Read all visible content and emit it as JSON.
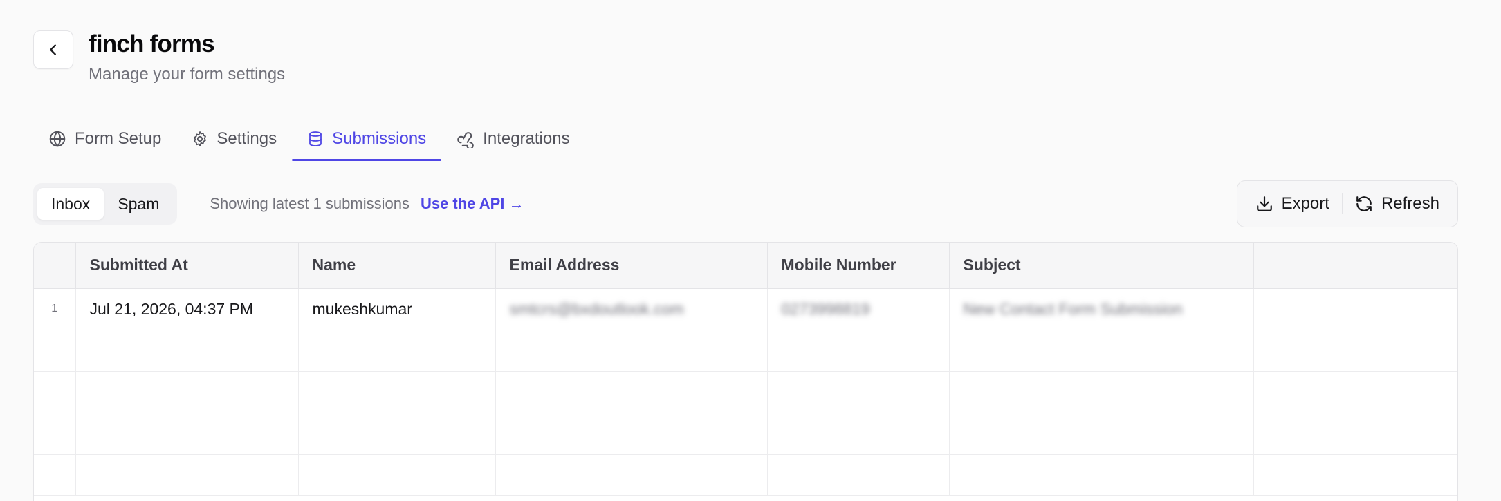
{
  "header": {
    "title": "finch forms",
    "subtitle": "Manage your form settings"
  },
  "tabs": [
    {
      "label": "Form Setup",
      "icon": "globe-icon"
    },
    {
      "label": "Settings",
      "icon": "gear-icon"
    },
    {
      "label": "Submissions",
      "icon": "database-icon",
      "active": true
    },
    {
      "label": "Integrations",
      "icon": "webhook-icon"
    }
  ],
  "toolbar": {
    "inbox_label": "Inbox",
    "spam_label": "Spam",
    "showing_text": "Showing latest 1 submissions",
    "api_link": "Use the API →",
    "export_label": "Export",
    "refresh_label": "Refresh"
  },
  "table": {
    "columns": [
      "",
      "Submitted At",
      "Name",
      "Email Address",
      "Mobile Number",
      "Subject",
      ""
    ],
    "rows": [
      {
        "index": "1",
        "submitted_at": "Jul 21, 2026, 04:37 PM",
        "name": "mukeshkumar",
        "email": "smtcrs@bxdoutlook.com",
        "mobile": "0273998819",
        "subject": "New Contact Form Submission"
      }
    ]
  },
  "colors": {
    "accent": "#4f46e5",
    "muted_text": "#71717a",
    "border": "#e4e4e7"
  }
}
